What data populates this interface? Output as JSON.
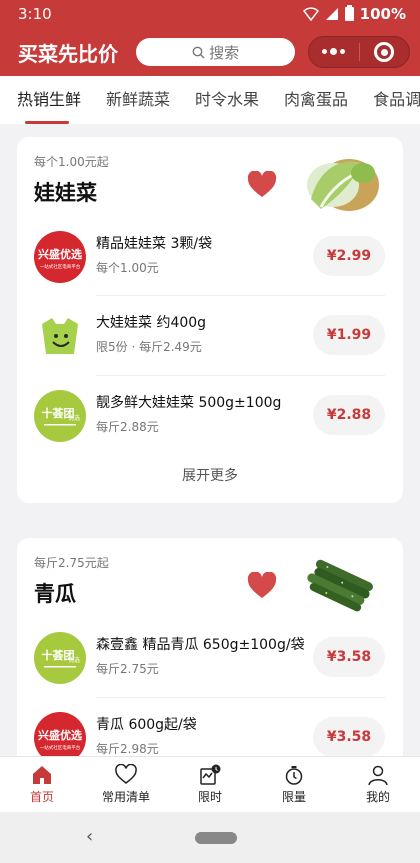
{
  "status": {
    "time": "3:10",
    "battery": "100%"
  },
  "header": {
    "title": "买菜先比价",
    "search_placeholder": "搜索"
  },
  "tabs": [
    {
      "label": "热销生鲜"
    },
    {
      "label": "新鲜蔬菜"
    },
    {
      "label": "时令水果"
    },
    {
      "label": "肉禽蛋品"
    },
    {
      "label": "食品调"
    }
  ],
  "cards": [
    {
      "subtitle": "每个1.00元起",
      "title": "娃娃菜",
      "more": "展开更多",
      "products": [
        {
          "logo": "兴盛优选",
          "logo_sub": "一站式社区电商平台",
          "name": "精品娃娃菜 3颗/袋",
          "sub": "每个1.00元",
          "price": "¥2.99"
        },
        {
          "logo": "",
          "name": "大娃娃菜 约400g",
          "sub": "限5份 · 每斤2.49元",
          "price": "¥1.99"
        },
        {
          "logo": "十荟团",
          "logo_sub": "优选",
          "name": "靓多鲜大娃娃菜 500g±100g",
          "sub": "每斤2.88元",
          "price": "¥2.88"
        }
      ]
    },
    {
      "subtitle": "每斤2.75元起",
      "title": "青瓜",
      "products": [
        {
          "logo": "十荟团",
          "logo_sub": "优选",
          "name": "森壹鑫 精品青瓜 650g±100g/袋",
          "sub": "每斤2.75元",
          "price": "¥3.58"
        },
        {
          "logo": "兴盛优选",
          "logo_sub": "一站式社区电商平台",
          "name": "青瓜 600g起/袋",
          "sub": "每斤2.98元",
          "price": "¥3.58"
        }
      ]
    }
  ],
  "bottom_nav": [
    {
      "label": "首页",
      "icon": "home-icon"
    },
    {
      "label": "常用清单",
      "icon": "heart-icon"
    },
    {
      "label": "限时",
      "icon": "clock-calendar-icon"
    },
    {
      "label": "限量",
      "icon": "stopwatch-icon"
    },
    {
      "label": "我的",
      "icon": "user-icon"
    }
  ],
  "colors": {
    "brand": "#c73a3a",
    "price": "#c73a3a"
  }
}
